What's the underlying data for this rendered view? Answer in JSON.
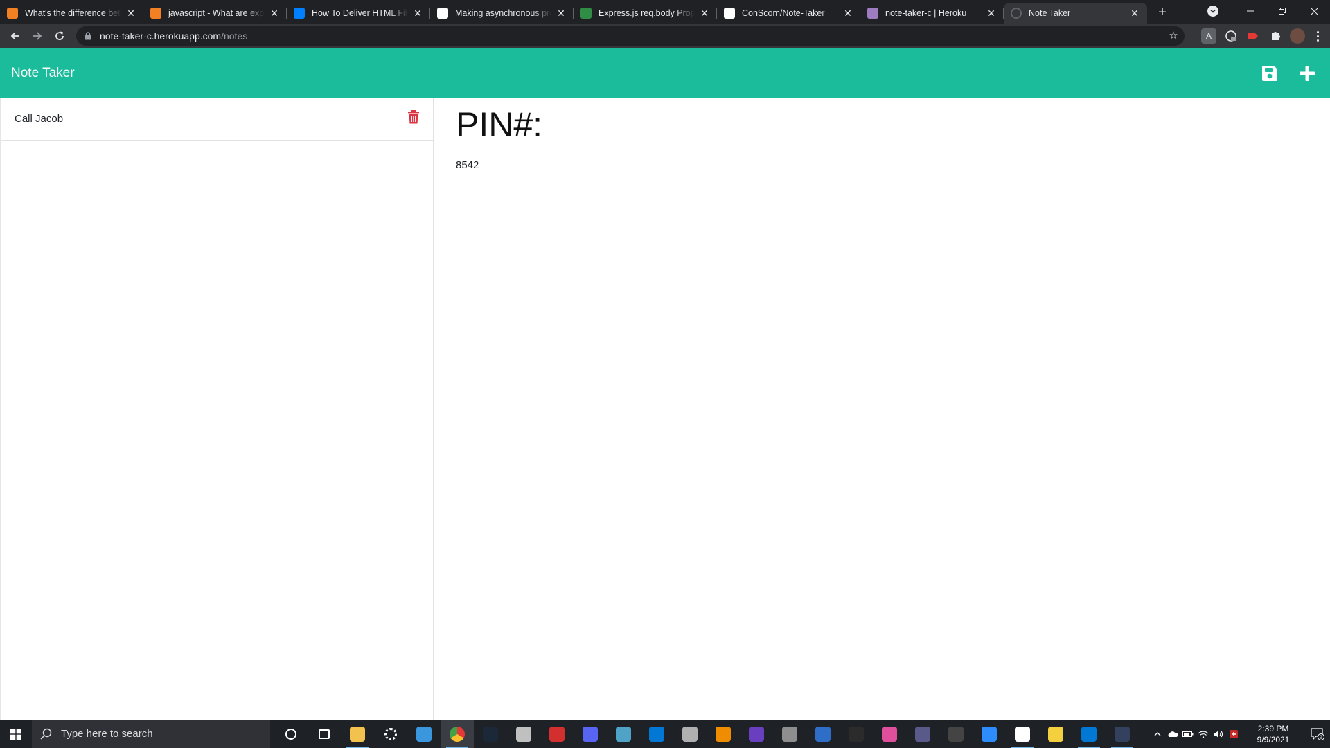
{
  "browser": {
    "tabs": [
      {
        "title": "What's the difference betw",
        "favicon": "stackoverflow-icon",
        "color": "#f48024"
      },
      {
        "title": "javascript - What are expre",
        "favicon": "stackoverflow-icon",
        "color": "#f48024"
      },
      {
        "title": "How To Deliver HTML Files",
        "favicon": "digitalocean-icon",
        "color": "#0080ff"
      },
      {
        "title": "Making asynchronous prog",
        "favicon": "mdn-icon",
        "color": "#ffffff"
      },
      {
        "title": "Express.js req.body Proper",
        "favicon": "geeksforgeeks-icon",
        "color": "#2f8d46"
      },
      {
        "title": "ConScom/Note-Taker",
        "favicon": "github-icon",
        "color": "#ffffff"
      },
      {
        "title": "note-taker-c | Heroku",
        "favicon": "heroku-icon",
        "color": "#9e7cc1"
      },
      {
        "title": "Note Taker",
        "favicon": "default-page-icon",
        "color": "#5f6368",
        "active": true
      }
    ],
    "url_host": "note-taker-c.herokuapp.com",
    "url_path": "/notes"
  },
  "app": {
    "brand": "Note Taker",
    "accent": "#1abc9c",
    "notes": [
      {
        "title": "Call Jacob"
      }
    ],
    "active_note": {
      "title": "PIN#:",
      "text": "8542"
    },
    "delete_color": "#dc3545"
  },
  "taskbar": {
    "search_placeholder": "Type here to search",
    "time": "2:39 PM",
    "date": "9/9/2021",
    "notifications": "2"
  }
}
